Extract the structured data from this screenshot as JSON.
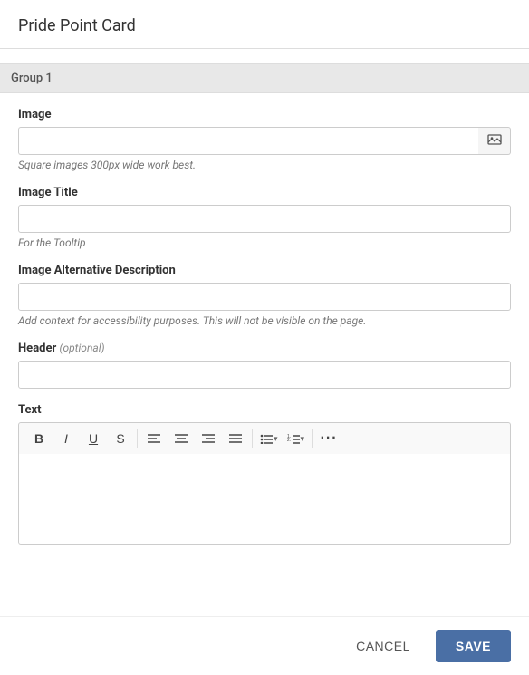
{
  "page": {
    "title": "Pride Point Card"
  },
  "group": {
    "label": "Group 1"
  },
  "fields": {
    "image": {
      "label": "Image",
      "hint": "Square images 300px wide work best.",
      "placeholder": "",
      "browse_icon": "🖼"
    },
    "image_title": {
      "label": "Image Title",
      "hint": "For the Tooltip",
      "placeholder": ""
    },
    "image_alt": {
      "label": "Image Alternative Description",
      "hint": "Add context for accessibility purposes. This will not be visible on the page.",
      "placeholder": ""
    },
    "header": {
      "label": "Header",
      "optional_label": "(optional)",
      "placeholder": ""
    },
    "text": {
      "label": "Text"
    }
  },
  "toolbar": {
    "bold": "B",
    "italic": "I",
    "underline": "U",
    "strikethrough": "S",
    "align_left": "≡",
    "align_center": "≡",
    "align_right": "≡",
    "align_justify": "≡",
    "unordered_list": "☰",
    "ordered_list": "☰",
    "more": "•••"
  },
  "footer": {
    "cancel_label": "CANCEL",
    "save_label": "SAVE"
  }
}
